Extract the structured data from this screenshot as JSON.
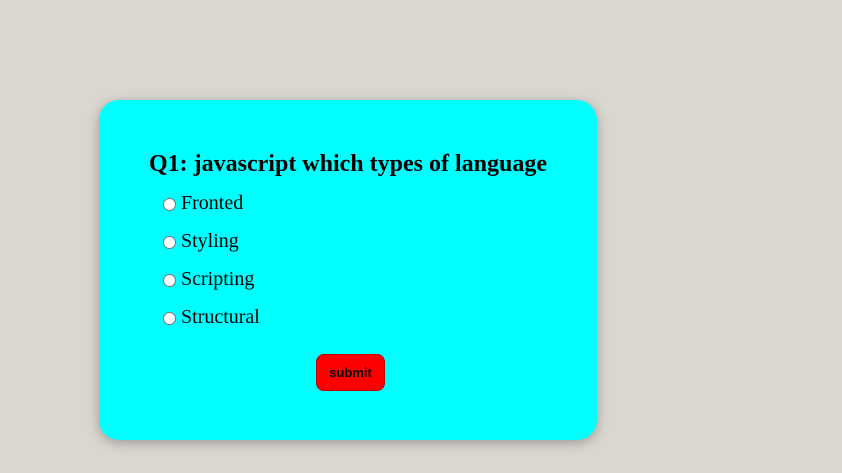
{
  "quiz": {
    "question": "Q1: javascript which types of language",
    "group_name": "q1",
    "options": [
      {
        "label": "Fronted",
        "checked": false
      },
      {
        "label": "Styling",
        "checked": false
      },
      {
        "label": "Scripting",
        "checked": false
      },
      {
        "label": "Structural",
        "checked": false
      }
    ],
    "submit_label": "submit"
  },
  "colors": {
    "page_background": "#dad7d1",
    "card_background": "#00ffff",
    "submit_background": "#ff0000",
    "text": "#000000"
  }
}
